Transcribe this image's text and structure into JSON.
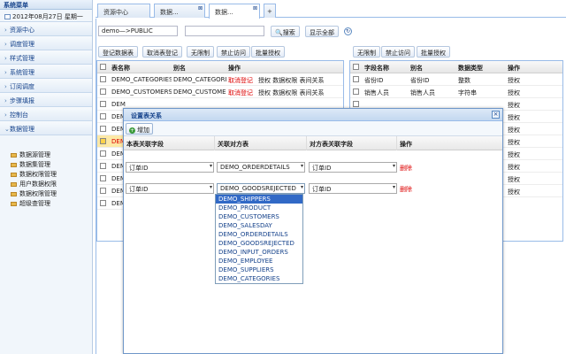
{
  "sidebar": {
    "title": "系统菜单",
    "date_text": "2012年08月27日 星期一",
    "sections": [
      {
        "label": "资源中心",
        "arrow": "›"
      },
      {
        "label": "调度管理",
        "arrow": "›"
      },
      {
        "label": "样式管理",
        "arrow": "›"
      },
      {
        "label": "系统管理",
        "arrow": "›"
      },
      {
        "label": "订阅调度",
        "arrow": "›"
      },
      {
        "label": "步骤填报",
        "arrow": "›"
      },
      {
        "label": "控制台",
        "arrow": "›"
      },
      {
        "label": "数据管理",
        "arrow": "⌄"
      }
    ],
    "items": [
      {
        "label": "数据源管理"
      },
      {
        "label": "数据集管理"
      },
      {
        "label": "数据权限管理"
      },
      {
        "label": "用户数据权限"
      },
      {
        "label": "数据权限管理"
      },
      {
        "label": "超级查管理"
      }
    ]
  },
  "tabs": [
    {
      "label": "资源中心"
    },
    {
      "label": "数据..."
    },
    {
      "label": "数据..."
    },
    {
      "label": "+"
    }
  ],
  "toolbar": {
    "path_value": "demo—>PUBLIC",
    "search_input_value": "",
    "search_label": "搜索",
    "show_all_label": "显示全部"
  },
  "left_grid": {
    "buttons": [
      "登记数据表",
      "取消表登记",
      "无限制",
      "禁止访问",
      "批量授权"
    ],
    "headers": [
      "表名称",
      "别名",
      "操作"
    ],
    "rows": [
      {
        "name": "DEMO_CATEGORIES",
        "alias": "DEMO_CATEGORIES",
        "op1": "取消登记",
        "op2": "授权 数据权限 表间关系"
      },
      {
        "name": "DEMO_CUSTOMERS",
        "alias": "DEMO_CUSTOMERS",
        "op1": "取消登记",
        "op2": "授权 数据权限 表间关系"
      },
      {
        "name": "DEM",
        "alias": "",
        "op1": "",
        "op2": ""
      },
      {
        "name": "DEM",
        "alias": "",
        "op1": "",
        "op2": ""
      },
      {
        "name": "DEM",
        "alias": "",
        "op1": "",
        "op2": ""
      },
      {
        "name": "DEM",
        "alias": "",
        "op1": "",
        "op2": ""
      },
      {
        "name": "DEM",
        "alias": "",
        "op1": "",
        "op2": ""
      },
      {
        "name": "DEM",
        "alias": "",
        "op1": "",
        "op2": ""
      },
      {
        "name": "DEM",
        "alias": "",
        "op1": "",
        "op2": ""
      },
      {
        "name": "DEM",
        "alias": "",
        "op1": "",
        "op2": ""
      },
      {
        "name": "DEM",
        "alias": "",
        "op1": "",
        "op2": ""
      }
    ]
  },
  "right_grid": {
    "buttons": [
      "无限制",
      "禁止访问",
      "批量授权"
    ],
    "headers": [
      "字段名称",
      "别名",
      "数据类型",
      "操作"
    ],
    "rows": [
      {
        "name": "省份ID",
        "alias": "省份ID",
        "type": "整数",
        "op": "授权"
      },
      {
        "name": "销售人员",
        "alias": "销售人员",
        "type": "字符串",
        "op": "授权"
      },
      {
        "op": "授权"
      },
      {
        "op": "授权"
      },
      {
        "op": "授权"
      },
      {
        "op": "授权"
      },
      {
        "op": "授权"
      },
      {
        "op": "授权"
      },
      {
        "op": "授权"
      },
      {
        "op": "授权"
      }
    ]
  },
  "modal": {
    "title": "设置表关系",
    "close_glyph": "×",
    "add_label": "增加",
    "headers": [
      "本表关联字段",
      "关联对方表",
      "对方表关联字段",
      "操作"
    ],
    "rows": [
      {
        "local_field": "订单ID",
        "target_table": "DEMO_ORDERDETAILS",
        "target_field": "订单ID",
        "op": "删除"
      },
      {
        "local_field": "订单ID",
        "target_table": "DEMO_GOODSREJECTED",
        "target_field": "订单ID",
        "op": "删除"
      }
    ],
    "dropdown_options": [
      "DEMO_SHIPPERS",
      "DEMO_PRODUCT",
      "DEMO_CUSTOMERS",
      "DEMO_SALESDAY",
      "DEMO_ORDERDETAILS",
      "DEMO_GOODSREJECTED",
      "DEMO_INPUT_ORDERS",
      "DEMO_EMPLOYEE",
      "DEMO_SUPPLIERS",
      "DEMO_CATEGORIES"
    ],
    "dropdown_highlighted": "DEMO_SHIPPERS"
  },
  "colors": {
    "accent": "#15428b",
    "border": "#99bbe8",
    "danger": "#dd0000",
    "highlight": "#3169c6"
  }
}
